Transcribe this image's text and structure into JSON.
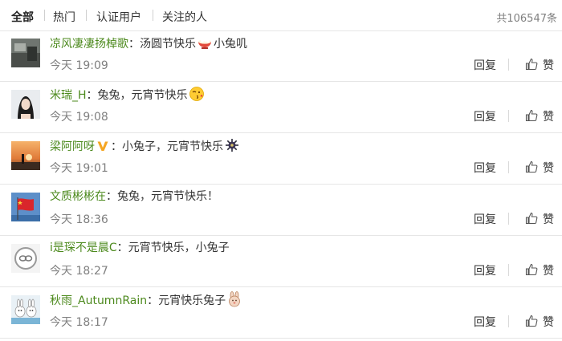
{
  "tabs": [
    {
      "label": "全部",
      "active": true
    },
    {
      "label": "热门",
      "active": false
    },
    {
      "label": "认证用户",
      "active": false
    },
    {
      "label": "关注的人",
      "active": false
    }
  ],
  "total_count": "共106547条",
  "actions": {
    "reply_label": "回复",
    "like_label": "赞"
  },
  "colors": {
    "username": "#4d8a1e",
    "time": "#808080",
    "divider": "#e6e6e6",
    "verified_badge": "#f5a623"
  },
  "comments": [
    {
      "user": "凉风凄凄扬棹歌",
      "colon": "：",
      "text_before": "汤圆节快乐",
      "emoji": "rice-bowl-emoji",
      "text_after": "小兔叽",
      "time": "今天 19:09"
    },
    {
      "user": "米瑞_H",
      "colon": "：",
      "text_before": "兔兔，元宵节快乐",
      "emoji": "kiss-face-emoji",
      "text_after": "",
      "time": "今天 19:08"
    },
    {
      "user": "梁阿阿呀",
      "colon": "：",
      "text_before": "小兔子，元宵节快乐",
      "emoji": "firework-emoji",
      "text_after": "",
      "time": "今天 19:01",
      "verified": true
    },
    {
      "user": "文质彬彬在",
      "colon": "：",
      "text_before": "兔兔，元宵节快乐！",
      "emoji": "",
      "text_after": "",
      "time": "今天 18:36"
    },
    {
      "user": "i是琛不是晨C",
      "colon": "：",
      "text_before": "元宵节快乐，小兔子",
      "emoji": "",
      "text_after": "",
      "time": "今天 18:27"
    },
    {
      "user": "秋雨_AutumnRain",
      "colon": "：",
      "text_before": "元宵快乐兔子",
      "emoji": "bunny-emoji",
      "text_after": "",
      "time": "今天 18:17"
    }
  ]
}
